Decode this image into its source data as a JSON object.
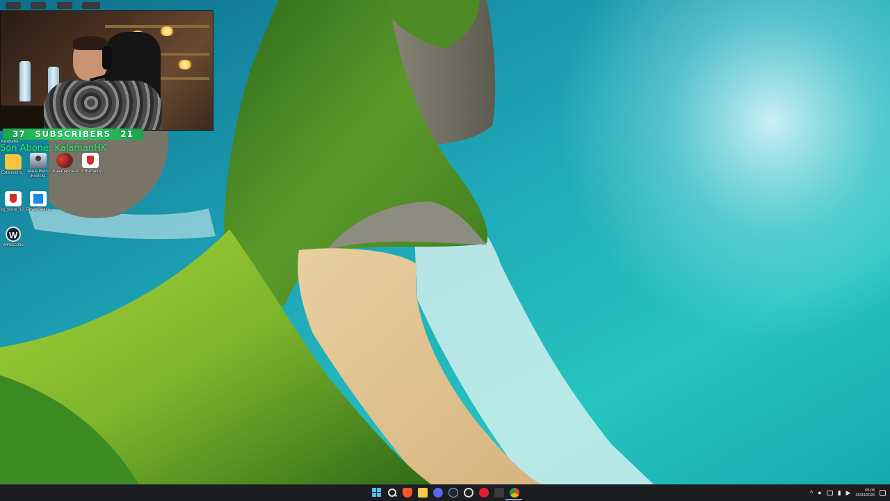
{
  "overlay": {
    "subscriber_left": "37",
    "subscriber_label": "SUBSCRIBERS",
    "subscriber_right": "21",
    "last_subscriber": "Son Abone: KalamanHK"
  },
  "desktop": {
    "header_label": "Karabudak...",
    "icons": [
      {
        "label": "Extensions...",
        "icon": "folder-icon"
      },
      {
        "label": "Made Retro Exorcist",
        "icon": "person-icon"
      },
      {
        "label": "KalamanNest",
        "icon": "team-icon"
      },
      {
        "label": "DCRatSetup...",
        "icon": "shield-app-icon"
      },
      {
        "label": "iq_score_12...",
        "icon": "shield-app-icon"
      },
      {
        "label": "PowerSettin...",
        "icon": "blue-square-icon"
      },
      {
        "label": "Windscribe",
        "icon": "windscribe-icon"
      }
    ]
  },
  "taskbar": {
    "apps": [
      "start-icon",
      "search-icon",
      "brave-icon",
      "file-explorer-icon",
      "discord-icon",
      "steam-icon",
      "obs-icon",
      "opera-icon",
      "terminal-icon",
      "chrome-icon"
    ],
    "clock_time": "05:08",
    "clock_date": "25/03/2026",
    "tray_chevron": "^"
  },
  "colors": {
    "subscriber_bar": "#2fd466",
    "last_sub_text": "#34e07a",
    "taskbar_bg": "#1c1d21",
    "ocean": "#1fa0b4"
  }
}
